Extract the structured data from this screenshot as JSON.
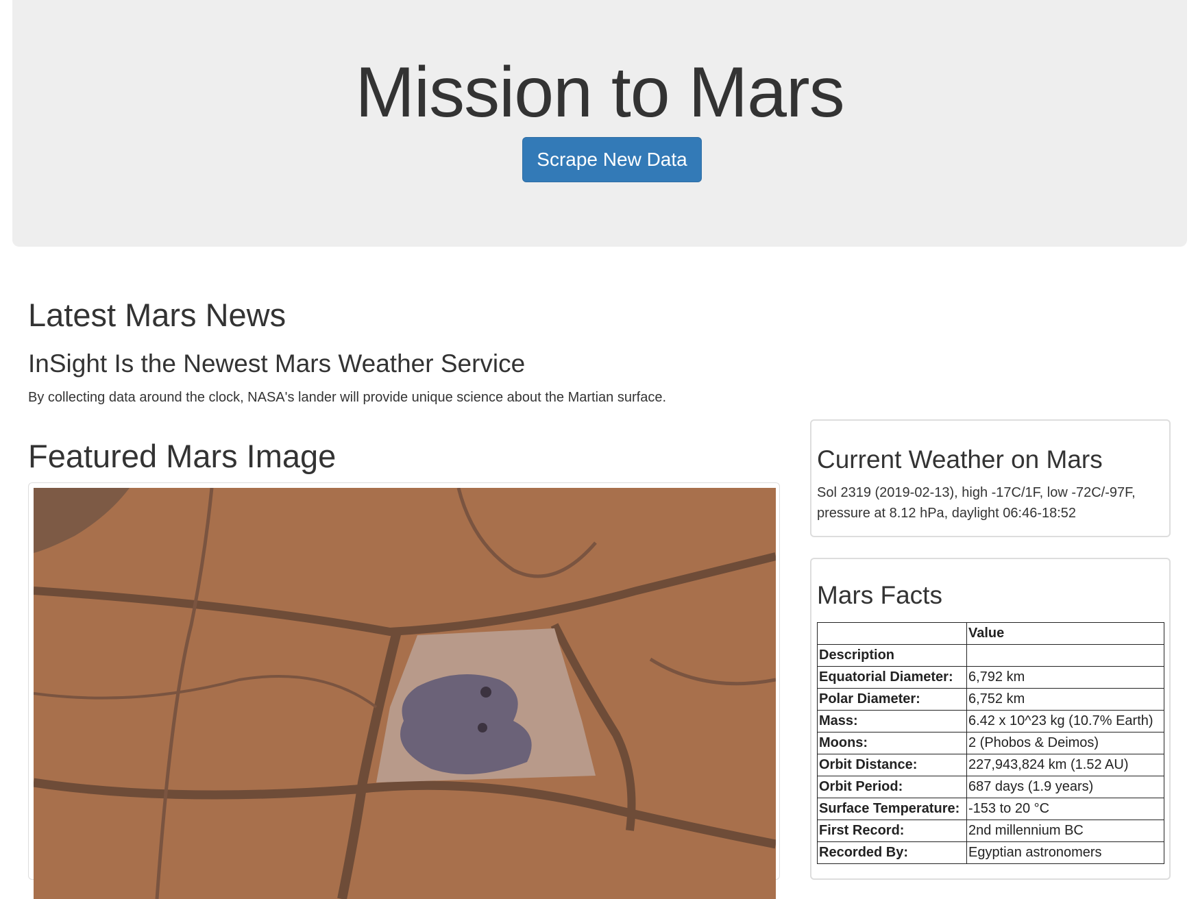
{
  "header": {
    "title": "Mission to Mars",
    "scrape_button": "Scrape New Data"
  },
  "news": {
    "heading": "Latest Mars News",
    "title": "InSight Is the Newest Mars Weather Service",
    "teaser": "By collecting data around the clock, NASA's lander will provide unique science about the Martian surface."
  },
  "featured": {
    "heading": "Featured Mars Image"
  },
  "weather": {
    "heading": "Current Weather on Mars",
    "text": "Sol 2319 (2019-02-13), high -17C/1F, low -72C/-97F, pressure at 8.12 hPa, daylight 06:46-18:52"
  },
  "facts": {
    "heading": "Mars Facts",
    "columns": [
      "",
      "Value"
    ],
    "index_label": "Description",
    "rows": [
      {
        "key": "Equatorial Diameter:",
        "value": "6,792 km"
      },
      {
        "key": "Polar Diameter:",
        "value": "6,752 km"
      },
      {
        "key": "Mass:",
        "value": "6.42 x 10^23 kg (10.7% Earth)"
      },
      {
        "key": "Moons:",
        "value": "2 (Phobos & Deimos)"
      },
      {
        "key": "Orbit Distance:",
        "value": "227,943,824 km (1.52 AU)"
      },
      {
        "key": "Orbit Period:",
        "value": "687 days (1.9 years)"
      },
      {
        "key": "Surface Temperature:",
        "value": "-153 to 20 °C"
      },
      {
        "key": "First Record:",
        "value": "2nd millennium BC"
      },
      {
        "key": "Recorded By:",
        "value": "Egyptian astronomers"
      }
    ]
  }
}
